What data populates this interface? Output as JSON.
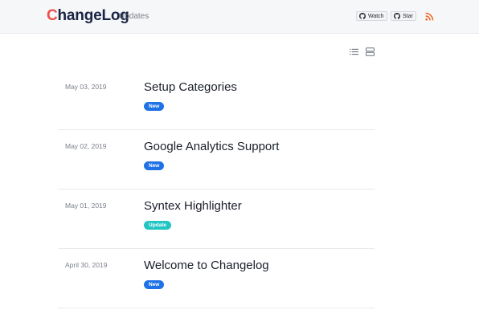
{
  "header": {
    "logo_initial": "C",
    "logo_rest": "hangeLog",
    "nav_link": "Updates",
    "watch_label": "Watch",
    "star_label": "Star"
  },
  "colors": {
    "new_badge": "#1f72e6",
    "update_badge": "#23c4c4",
    "rss": "#f26522"
  },
  "entries": [
    {
      "date": "May 03, 2019",
      "title": "Setup Categories",
      "badge": "New"
    },
    {
      "date": "May 02, 2019",
      "title": "Google Analytics Support",
      "badge": "New"
    },
    {
      "date": "May 01, 2019",
      "title": "Syntex Highlighter",
      "badge": "Update"
    },
    {
      "date": "April 30, 2019",
      "title": "Welcome to Changelog",
      "badge": "New"
    }
  ]
}
